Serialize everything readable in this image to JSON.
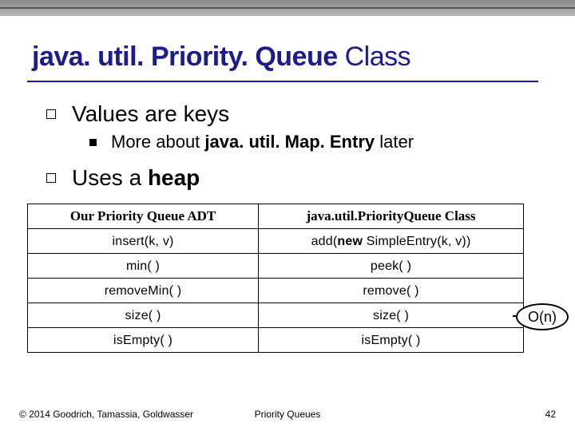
{
  "title": {
    "bold_part": "java. util. Priority. Queue",
    "light_part": " Class"
  },
  "bullets": {
    "b1": "Values are keys",
    "b1_sub_prefix": "More about ",
    "b1_sub_bold": "java. util. Map. Entry",
    "b1_sub_suffix": " later",
    "b2_prefix": "Uses a ",
    "b2_bold": "heap"
  },
  "table": {
    "h1": "Our Priority Queue ADT",
    "h2": "java.util.PriorityQueue Class",
    "rows": [
      {
        "left": "insert(k, v)",
        "right_pre": "add(",
        "right_bold": "new",
        "right_post": " SimpleEntry(k, v))"
      },
      {
        "left": "min( )",
        "right": "peek( )"
      },
      {
        "left": "removeMin( )",
        "right": "remove( )"
      },
      {
        "left": "size( )",
        "right": "size( )"
      },
      {
        "left": "isEmpty( )",
        "right": "isEmpty( )"
      }
    ]
  },
  "callout": "O(n)",
  "footer": {
    "left": "© 2014 Goodrich, Tamassia, Goldwasser",
    "center": "Priority Queues",
    "right": "42"
  }
}
